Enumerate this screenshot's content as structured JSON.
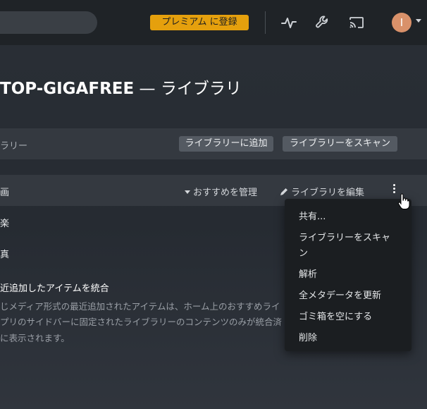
{
  "header": {
    "premium_label": "プレミアム に登録",
    "icons": [
      "activity-icon",
      "wrench-icon",
      "cast-icon"
    ],
    "avatar_initial": "I"
  },
  "page": {
    "title_bold": "TOP-GIGAFREE",
    "title_rest": " — ライブラリ"
  },
  "library_bar": {
    "label": "ラリー",
    "add_label": "ライブラリーに追加",
    "scan_label": "ライブラリーをスキャン"
  },
  "library_row": {
    "name": "画",
    "manage_recommendations": "おすすめを管理",
    "edit_library": "ライブラリを編集"
  },
  "other_libraries": [
    "楽",
    "真"
  ],
  "recent": {
    "title": "近追加したアイテムを統合",
    "desc_lines": [
      "じメディア形式の最近追加されたアイテムは、ホーム上のおすすめライ",
      "プリのサイドバーに固定されたライブラリーのコンテンツのみが統合済",
      "に表示されます。"
    ]
  },
  "context_menu": {
    "items": [
      "共有...",
      "ライブラリーをスキャ",
      "ン",
      "解析",
      "全メタデータを更新",
      "ゴミ箱を空にする",
      "削除"
    ]
  }
}
